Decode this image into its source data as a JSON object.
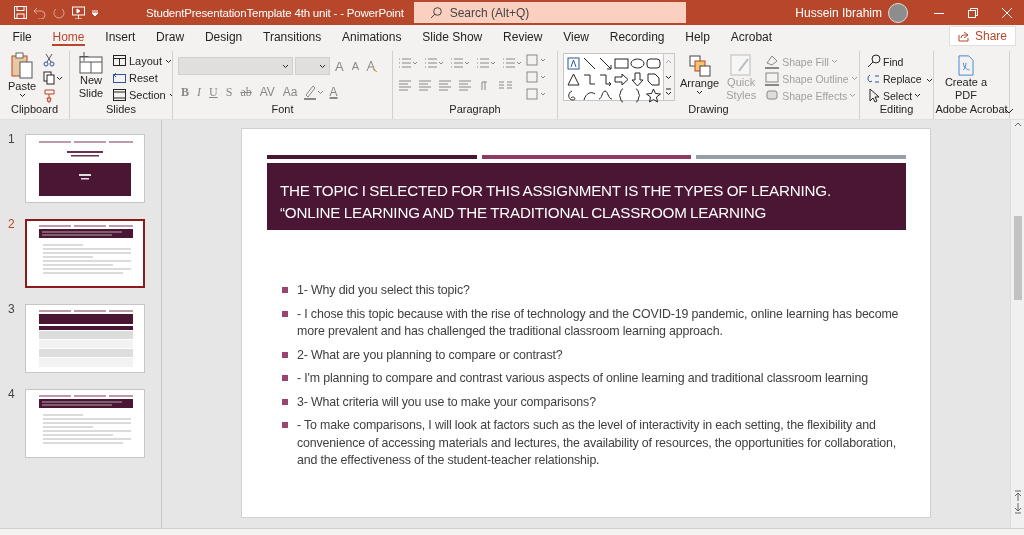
{
  "title_bar": {
    "document_title": "StudentPresentationTemplate 4th unit -  - PowerPoint",
    "search": {
      "placeholder": "Search (Alt+Q)"
    },
    "user_name": "Hussein Ibrahim"
  },
  "ribbon_tabs": [
    {
      "label": "File",
      "selected": false
    },
    {
      "label": "Home",
      "selected": true
    },
    {
      "label": "Insert",
      "selected": false
    },
    {
      "label": "Draw",
      "selected": false
    },
    {
      "label": "Design",
      "selected": false
    },
    {
      "label": "Transitions",
      "selected": false
    },
    {
      "label": "Animations",
      "selected": false
    },
    {
      "label": "Slide Show",
      "selected": false
    },
    {
      "label": "Review",
      "selected": false
    },
    {
      "label": "View",
      "selected": false
    },
    {
      "label": "Recording",
      "selected": false
    },
    {
      "label": "Help",
      "selected": false
    },
    {
      "label": "Acrobat",
      "selected": false
    }
  ],
  "share_button": "Share",
  "ribbon": {
    "clipboard": {
      "label": "Clipboard",
      "paste": "Paste"
    },
    "slides": {
      "label": "Slides",
      "new_slide": "New Slide",
      "commands": [
        "Layout",
        "Reset",
        "Section"
      ]
    },
    "font": {
      "label": "Font",
      "size_buttons": [
        "A",
        "A"
      ],
      "format_buttons": [
        "B",
        "I",
        "U",
        "S",
        "ab",
        "AV",
        "Aa"
      ],
      "font_color": "A"
    },
    "paragraph": {
      "label": "Paragraph"
    },
    "drawing": {
      "label": "Drawing",
      "arrange": "Arrange",
      "quick_styles": {
        "label": "Quick Styles",
        "disabled": true
      },
      "commands": [
        {
          "label": "Shape Fill",
          "disabled": true
        },
        {
          "label": "Shape Outline",
          "disabled": true
        },
        {
          "label": "Shape Effects",
          "disabled": true
        }
      ]
    },
    "editing": {
      "label": "Editing",
      "commands": [
        "Find",
        "Replace",
        "Select"
      ]
    },
    "acrobat": {
      "label": "Adobe Acrobat",
      "create_pdf": "Create a PDF"
    }
  },
  "slide_thumbnails": [
    {
      "number": "1",
      "kind": "title",
      "selected": false
    },
    {
      "number": "2",
      "kind": "bullets",
      "selected": true
    },
    {
      "number": "3",
      "kind": "table",
      "selected": false
    },
    {
      "number": "4",
      "kind": "bullets",
      "selected": false
    }
  ],
  "slide": {
    "title": "THE TOPIC I SELECTED FOR THIS ASSIGNMENT IS THE TYPES OF LEARNING. “ONLINE LEARNING AND THE TRADITIONAL  CLASSROOM LEARNING",
    "bullets": [
      "1- Why did you select this topic?",
      "- I chose this topic because with the rise of technology and the COVID-19 pandemic, online learning has become more prevalent and has challenged the traditional classroom learning approach.",
      "2- What are you planning to compare or contrast?",
      "- I'm planning to compare and contrast various aspects of online learning and traditional classroom learning",
      "3- What criteria will you use to make your comparisons?",
      "- To make comparisons, I will look at factors such as the level of interactivity in each setting, the flexibility and convenience of accessing materials and lectures, the availability of resources, the opportunities for collaboration, and the effectiveness of the student-teacher relationship."
    ]
  }
}
